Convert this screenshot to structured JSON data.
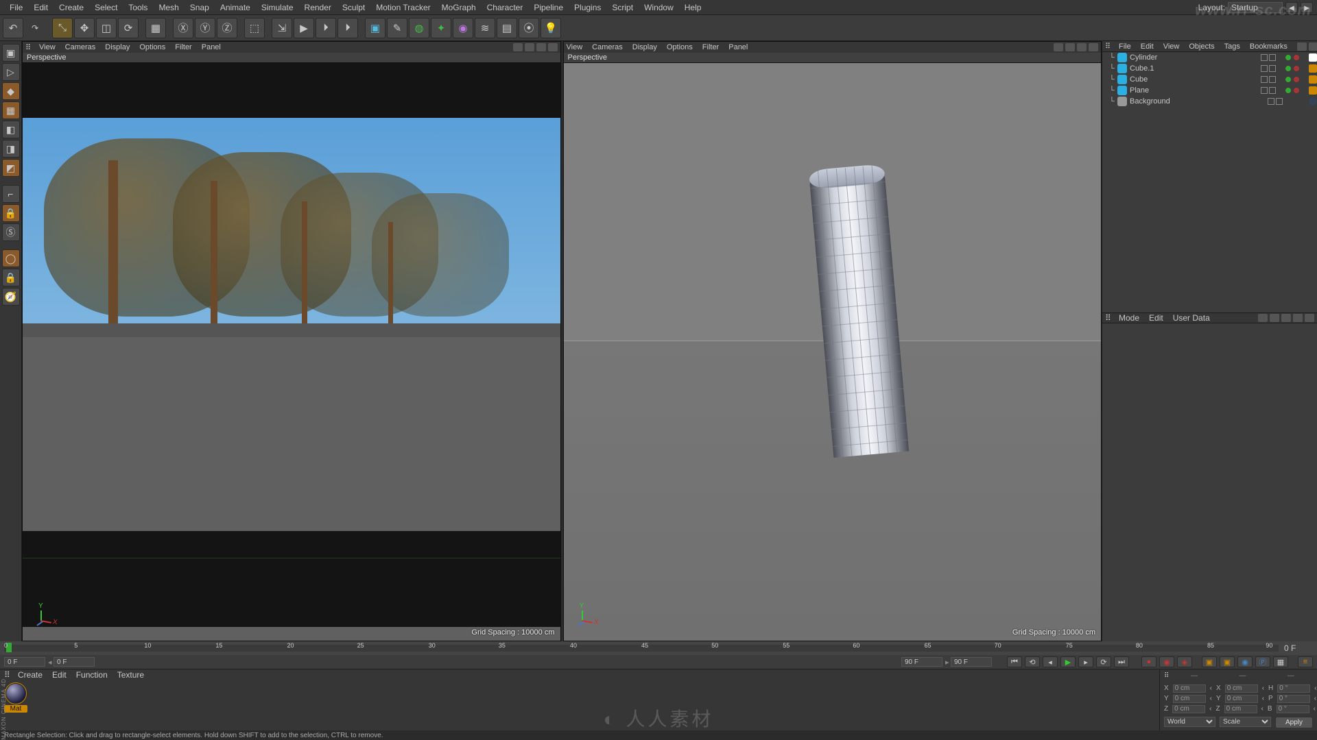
{
  "menu": {
    "items": [
      "File",
      "Edit",
      "Create",
      "Select",
      "Tools",
      "Mesh",
      "Snap",
      "Animate",
      "Simulate",
      "Render",
      "Sculpt",
      "Motion Tracker",
      "MoGraph",
      "Character",
      "Pipeline",
      "Plugins",
      "Script",
      "Window",
      "Help"
    ],
    "layout_label": "Layout:",
    "layout_value": "Startup"
  },
  "toolbar": {
    "icons": [
      "↶",
      "↷",
      "|",
      "⤡",
      "✥",
      "◫",
      "⟳",
      "|",
      "▦",
      "|",
      "Ⓧ",
      "Ⓨ",
      "Ⓩ",
      "|",
      "⬚",
      "⇲",
      "▶",
      "⏵",
      "⏵",
      "|",
      "▣",
      "✎",
      "◍",
      "✦",
      "◉",
      "≋",
      "▤",
      "⦿",
      "💡"
    ]
  },
  "left_tools": {
    "icons": [
      "▣",
      "▷",
      "◆",
      "▦",
      "◧",
      "◨",
      "◩",
      "│",
      "⌐",
      "🔒",
      "Ⓢ",
      "◯",
      "🔒",
      "🧭"
    ]
  },
  "viewports": {
    "menus": [
      "View",
      "Cameras",
      "Display",
      "Options",
      "Filter",
      "Panel"
    ],
    "left": {
      "title": "Perspective",
      "grid": "Grid Spacing : 10000 cm"
    },
    "right": {
      "title": "Perspective",
      "grid": "Grid Spacing : 10000 cm"
    }
  },
  "object_manager": {
    "menus": [
      "File",
      "Edit",
      "View",
      "Objects",
      "Tags",
      "Bookmarks"
    ],
    "rows": [
      {
        "icon": "#2bb0e4",
        "name": "Cylinder",
        "tag": "ref"
      },
      {
        "icon": "#2bb0e4",
        "name": "Cube.1",
        "tag": "phong"
      },
      {
        "icon": "#2bb0e4",
        "name": "Cube",
        "tag": "phong"
      },
      {
        "icon": "#2bb0e4",
        "name": "Plane",
        "tag": "phong"
      },
      {
        "icon": "#999999",
        "name": "Background",
        "tag": "mat"
      }
    ]
  },
  "attr_manager": {
    "menus": [
      "Mode",
      "Edit",
      "User Data"
    ]
  },
  "timeline": {
    "start": "0 F",
    "current": "0 F",
    "end": "90 F",
    "end2": "90 F",
    "range": "0 F",
    "ticks": [
      "0",
      "5",
      "10",
      "15",
      "20",
      "25",
      "30",
      "35",
      "40",
      "45",
      "50",
      "55",
      "60",
      "65",
      "70",
      "75",
      "80",
      "85",
      "90"
    ]
  },
  "materials": {
    "menus": [
      "Create",
      "Edit",
      "Function",
      "Texture"
    ],
    "items": [
      {
        "name": "Mat"
      }
    ]
  },
  "coords": {
    "rows": [
      {
        "a": "X",
        "av": "0 cm",
        "b": "X",
        "bv": "0 cm",
        "c": "H",
        "cv": "0 °"
      },
      {
        "a": "Y",
        "av": "0 cm",
        "b": "Y",
        "bv": "0 cm",
        "c": "P",
        "cv": "0 °"
      },
      {
        "a": "Z",
        "av": "0 cm",
        "b": "Z",
        "bv": "0 cm",
        "c": "B",
        "cv": "0 °"
      }
    ],
    "mode1": "World",
    "mode2": "Scale",
    "apply": "Apply"
  },
  "status": "Rectangle Selection: Click and drag to rectangle-select elements. Hold down SHIFT to add to the selection, CTRL to remove.",
  "watermark_top": "www.rr-sc.com",
  "watermark_bottom": "人人素材",
  "maxon": "MAXON  CINEMA 4D"
}
